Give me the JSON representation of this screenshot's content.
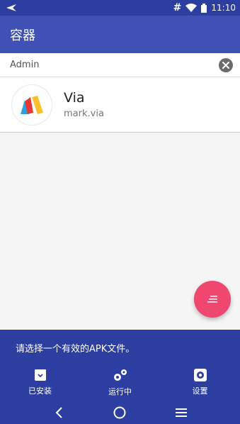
{
  "status_bar": {
    "time": "11:10",
    "hash": "#"
  },
  "app_bar": {
    "title": "容器"
  },
  "search": {
    "value": "Admin",
    "placeholder": ""
  },
  "apps": [
    {
      "name": "Via",
      "package": "mark.via",
      "icon": "via-logo-icon"
    }
  ],
  "fab": {
    "icon": "list-icon"
  },
  "message": "请选择一个有效的APK文件。",
  "tabs": [
    {
      "label": "已安装",
      "icon": "installed-box-icon"
    },
    {
      "label": "运行中",
      "icon": "gears-icon"
    },
    {
      "label": "设置",
      "icon": "settings-gear-icon"
    }
  ],
  "colors": {
    "primary": "#3f51b5",
    "primary_dark": "#2c3e9f",
    "accent": "#ef476f"
  }
}
